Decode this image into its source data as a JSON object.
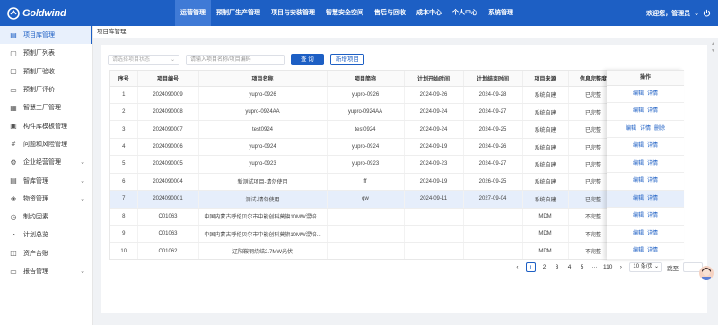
{
  "brand": {
    "name": "Goldwind"
  },
  "nav": [
    {
      "label": "运营管理",
      "active": true
    },
    {
      "label": "预制厂生产管理",
      "active": false
    },
    {
      "label": "项目与安装管理",
      "active": false
    },
    {
      "label": "智慧安全空间",
      "active": false
    },
    {
      "label": "售后与回收",
      "active": false
    },
    {
      "label": "成本中心",
      "active": false
    },
    {
      "label": "个人中心",
      "active": false
    },
    {
      "label": "系统管理",
      "active": false
    }
  ],
  "user": {
    "greeting": "欢迎您，管理员",
    "caret": "⌄",
    "logout_icon": "logout-icon"
  },
  "sidebar": [
    {
      "label": "项目库管理",
      "icon": "doc-icon",
      "glyph": "▤",
      "active": true,
      "expandable": false
    },
    {
      "label": "预制厂列表",
      "icon": "file-icon",
      "glyph": "▢",
      "active": false,
      "expandable": false
    },
    {
      "label": "预制厂验收",
      "icon": "file-check-icon",
      "glyph": "▢",
      "active": false,
      "expandable": false
    },
    {
      "label": "预制厂评价",
      "icon": "clipboard-icon",
      "glyph": "▭",
      "active": false,
      "expandable": false
    },
    {
      "label": "智慧工厂管理",
      "icon": "grid-icon",
      "glyph": "▦",
      "active": false,
      "expandable": false
    },
    {
      "label": "构件库模板管理",
      "icon": "template-icon",
      "glyph": "▣",
      "active": false,
      "expandable": false
    },
    {
      "label": "问题和风险管理",
      "icon": "hash-icon",
      "glyph": "#",
      "active": false,
      "expandable": false
    },
    {
      "label": "企业经营管理",
      "icon": "gear-icon",
      "glyph": "⚙",
      "active": false,
      "expandable": true
    },
    {
      "label": "智库管理",
      "icon": "folder-icon",
      "glyph": "▤",
      "active": false,
      "expandable": true
    },
    {
      "label": "物资管理",
      "icon": "box-icon",
      "glyph": "◈",
      "active": false,
      "expandable": true
    },
    {
      "label": "制约因素",
      "icon": "alert-icon",
      "glyph": "◷",
      "active": false,
      "expandable": false
    },
    {
      "label": "计划总览",
      "icon": "clock-icon",
      "glyph": "◔",
      "active": false,
      "expandable": false
    },
    {
      "label": "资产台账",
      "icon": "cube-icon",
      "glyph": "◫",
      "active": false,
      "expandable": false
    },
    {
      "label": "报告管理",
      "icon": "monitor-icon",
      "glyph": "▭",
      "active": false,
      "expandable": true
    }
  ],
  "breadcrumb": "项目库管理",
  "filters": {
    "status_placeholder": "请选择项目状态",
    "search_placeholder": "请输入项目名称/项目编码",
    "query_label": "查 询",
    "add_label": "新增项目"
  },
  "table": {
    "columns": [
      "序号",
      "项目编号",
      "项目名称",
      "项目简称",
      "计划开始时间",
      "计划结束时间",
      "项目来源",
      "信息完整度"
    ],
    "op_header": "操作",
    "rows": [
      {
        "cells": [
          "1",
          "2024090009",
          "yupro-0926",
          "yupro-0926",
          "2024-09-26",
          "2024-09-28",
          "系统自建",
          "已完整"
        ],
        "ops": [
          "编辑",
          "详情"
        ],
        "hl": false
      },
      {
        "cells": [
          "2",
          "2024090008",
          "yupro-0924AA",
          "yupro-0924AA",
          "2024-09-24",
          "2024-09-27",
          "系统自建",
          "已完整"
        ],
        "ops": [
          "编辑",
          "详情"
        ],
        "hl": false
      },
      {
        "cells": [
          "3",
          "2024090007",
          "test0924",
          "test0924",
          "2024-09-24",
          "2024-09-25",
          "系统自建",
          "已完整"
        ],
        "ops": [
          "编辑",
          "详情",
          "删除"
        ],
        "hl": false
      },
      {
        "cells": [
          "4",
          "2024090006",
          "yupro-0924",
          "yupro-0924",
          "2024-09-19",
          "2024-09-26",
          "系统自建",
          "已完整"
        ],
        "ops": [
          "编辑",
          "详情"
        ],
        "hl": false
      },
      {
        "cells": [
          "5",
          "2024090005",
          "yupro-0923",
          "yupro-0923",
          "2024-09-23",
          "2024-09-27",
          "系统自建",
          "已完整"
        ],
        "ops": [
          "编辑",
          "详情"
        ],
        "hl": false
      },
      {
        "cells": [
          "6",
          "2024090004",
          "新测试项目-请勿使用",
          "ff",
          "2024-09-19",
          "2026-09-25",
          "系统自建",
          "已完整"
        ],
        "ops": [
          "编辑",
          "详情"
        ],
        "hl": false
      },
      {
        "cells": [
          "7",
          "2024090001",
          "测试-请勿使用",
          "qw",
          "2024-09-11",
          "2027-09-04",
          "系统自建",
          "已完整"
        ],
        "ops": [
          "编辑",
          "详情"
        ],
        "hl": true
      },
      {
        "cells": [
          "8",
          "C01063",
          "中国内蒙古呼伦贝尔市中能创科莫旗10MW混培...",
          "",
          "",
          "",
          "MDM",
          "不完整"
        ],
        "ops": [
          "编辑",
          "详情"
        ],
        "hl": false
      },
      {
        "cells": [
          "9",
          "C01063",
          "中国内蒙古呼伦贝尔市中能创科莫旗10MW混培...",
          "",
          "",
          "",
          "MDM",
          "不完整"
        ],
        "ops": [
          "编辑",
          "详情"
        ],
        "hl": false
      },
      {
        "cells": [
          "10",
          "C01062",
          "辽阳鞍钢烧结2.7MW光伏",
          "",
          "",
          "",
          "MDM",
          "不完整"
        ],
        "ops": [
          "编辑",
          "详情"
        ],
        "hl": false
      }
    ]
  },
  "pagination": {
    "prev": "‹",
    "pages": [
      "1",
      "2",
      "3",
      "4",
      "5"
    ],
    "current": "1",
    "ellipsis": "···",
    "last": "110",
    "next": "›",
    "page_size": "10 条/页",
    "jump_label": "跳至",
    "jump_value": ""
  },
  "colors": {
    "primary": "#1d5fc4",
    "highlight_row": "#e6eefb"
  }
}
